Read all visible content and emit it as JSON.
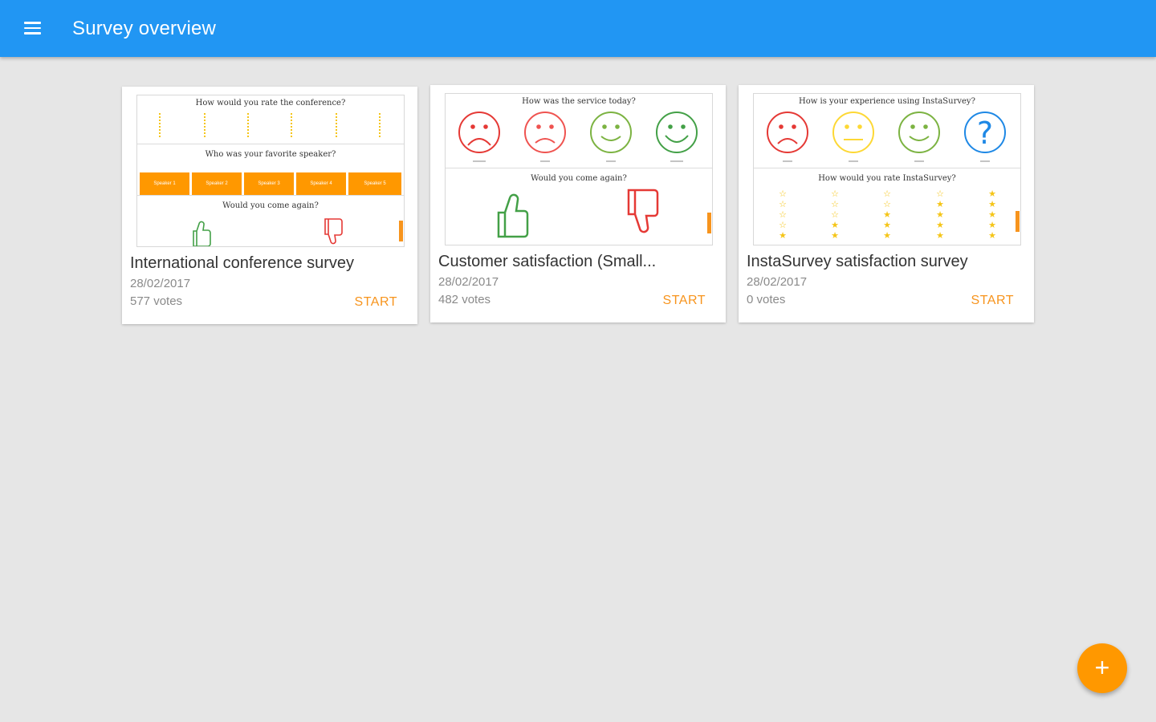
{
  "appbar": {
    "title": "Survey overview",
    "menu_icon": "menu-icon"
  },
  "surveys": [
    {
      "title": "International conference survey",
      "date": "28/02/2017",
      "votes": "577 votes",
      "action": "START",
      "preview": {
        "q1": "How would you rate the conference?",
        "q2": "Who was your favorite speaker?",
        "q2_options": [
          "Speaker 1",
          "Speaker 2",
          "Speaker 3",
          "Speaker 4",
          "Speaker 5"
        ],
        "q3": "Would you come again?"
      }
    },
    {
      "title": "Customer satisfaction (Small...",
      "date": "28/02/2017",
      "votes": "482 votes",
      "action": "START",
      "preview": {
        "q1": "How was the service today?",
        "q2": "Would you come again?"
      }
    },
    {
      "title": "InstaSurvey satisfaction survey",
      "date": "28/02/2017",
      "votes": "0 votes",
      "action": "START",
      "preview": {
        "q1": "How is your experience using InstaSurvey?",
        "q2": "How would you rate InstaSurvey?"
      }
    }
  ],
  "fab": {
    "label": "+",
    "icon": "add-icon"
  },
  "colors": {
    "appbar": "#2196f3",
    "accent": "#ff9800",
    "background": "#e6e6e6",
    "sad": "#e53935",
    "neutral": "#fbc02d",
    "happy": "#43a047",
    "question": "#1e88e5"
  }
}
